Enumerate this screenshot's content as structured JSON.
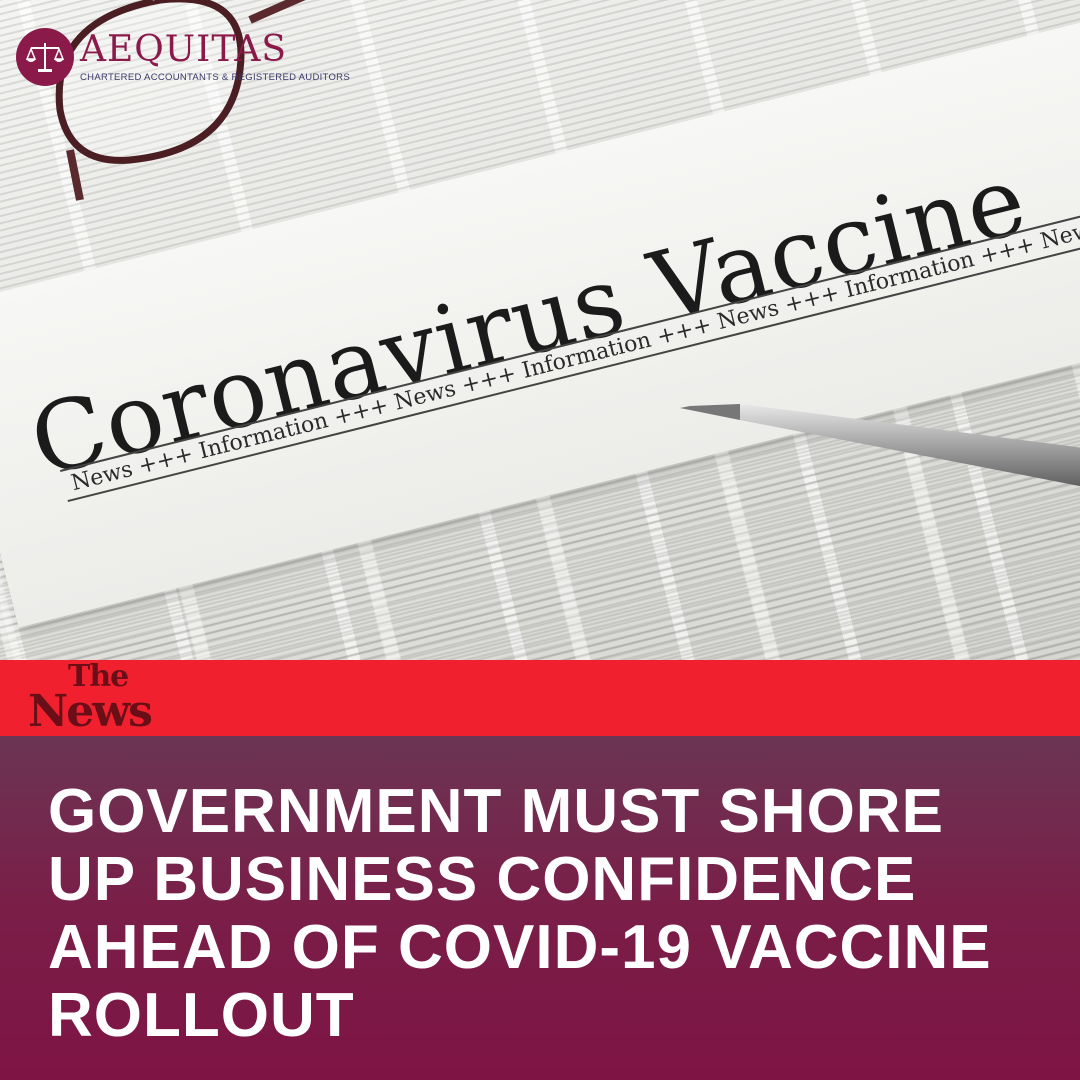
{
  "logo": {
    "name": "AEQUITAS",
    "tagline": "CHARTERED ACCOUNTANTS & REGISTERED AUDITORS"
  },
  "photo": {
    "headline": "Coronavirus Vaccine",
    "ticker": "News +++ Information +++ News +++ Information +++ News +++ Information +++ News"
  },
  "source": {
    "the": "The",
    "news": "News"
  },
  "article": {
    "title": "GOVERNMENT MUST SHORE UP BUSINESS CONFIDENCE AHEAD OF COVID-19 VACCINE ROLLOUT"
  },
  "colors": {
    "brand": "#8a1a4a",
    "red_band": "#f0202e",
    "panel": "#7a1e48"
  }
}
